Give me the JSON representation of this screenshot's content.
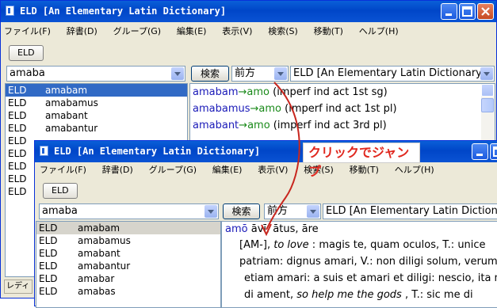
{
  "back": {
    "title": "ELD [An Elementary Latin Dictionary]",
    "menu": [
      "ファイル(F)",
      "辞書(D)",
      "グループ(G)",
      "編集(E)",
      "表示(V)",
      "検索(S)",
      "移動(T)",
      "ヘルプ(H)"
    ],
    "tool_button": "ELD",
    "search_value": "amaba",
    "search_button": "検索",
    "direction": "前方",
    "dictionary": "ELD [An Elementary Latin Dictionary]",
    "list": [
      {
        "dict": "ELD",
        "word": "amabam"
      },
      {
        "dict": "ELD",
        "word": "amabamus"
      },
      {
        "dict": "ELD",
        "word": "amabant"
      },
      {
        "dict": "ELD",
        "word": "amabantur"
      },
      {
        "dict": "ELD",
        "word": ""
      },
      {
        "dict": "ELD",
        "word": ""
      },
      {
        "dict": "ELD",
        "word": ""
      },
      {
        "dict": "ELD",
        "word": ""
      },
      {
        "dict": "ELD",
        "word": ""
      }
    ],
    "results": [
      {
        "form": "amabam",
        "arrow": "→",
        "lemma": "amo",
        "gloss": " (imperf ind act 1st sg)"
      },
      {
        "form": "amabamus",
        "arrow": "→",
        "lemma": "amo",
        "gloss": " (imperf ind act 1st pl)"
      },
      {
        "form": "amabant",
        "arrow": "→",
        "lemma": "amo",
        "gloss": " (imperf ind act 3rd pl)"
      }
    ],
    "status": "レディ"
  },
  "callout": "クリックでジャンプ",
  "front": {
    "title": "ELD [An Elementary Latin Dictionary]",
    "menu": [
      "ファイル(F)",
      "辞書(D)",
      "グループ(G)",
      "編集(E)",
      "表示(V)",
      "検索(S)",
      "移動(T)",
      "ヘルプ(H)"
    ],
    "tool_button": "ELD",
    "search_value": "amaba",
    "search_button": "検索",
    "direction": "前方",
    "dictionary": "ELD [An Elementary Latin Dictionary]",
    "list": [
      {
        "dict": "ELD",
        "word": "amabam"
      },
      {
        "dict": "ELD",
        "word": "amabamus"
      },
      {
        "dict": "ELD",
        "word": "amabant"
      },
      {
        "dict": "ELD",
        "word": "amabantur"
      },
      {
        "dict": "ELD",
        "word": "amabar"
      },
      {
        "dict": "ELD",
        "word": "amabas"
      }
    ],
    "entry": {
      "headword": "amō",
      "forms": " āvī, ātus, āre",
      "lines": [
        {
          "pre": "[AM-], ",
          "em": "to love",
          "post": " : magis te, quam oculos, T.: unice"
        },
        {
          "pre": "patriam: dignus amari, V.: non diligi solum, verum",
          "em": "",
          "post": ""
        },
        {
          "pre": "etiam amari: a suis et amari et diligi: nescio, ita me",
          "em": "",
          "post": ""
        },
        {
          "pre": "di ament, ",
          "em": "so help me the gods",
          "post": " , T.: sic me di"
        }
      ]
    }
  },
  "colors": {
    "title_blue": "#0a53d4",
    "selection": "#316ac5",
    "lemma_green": "#1a8a1a",
    "form_blue": "#1a1ab8",
    "callout_red": "#e0281f"
  }
}
